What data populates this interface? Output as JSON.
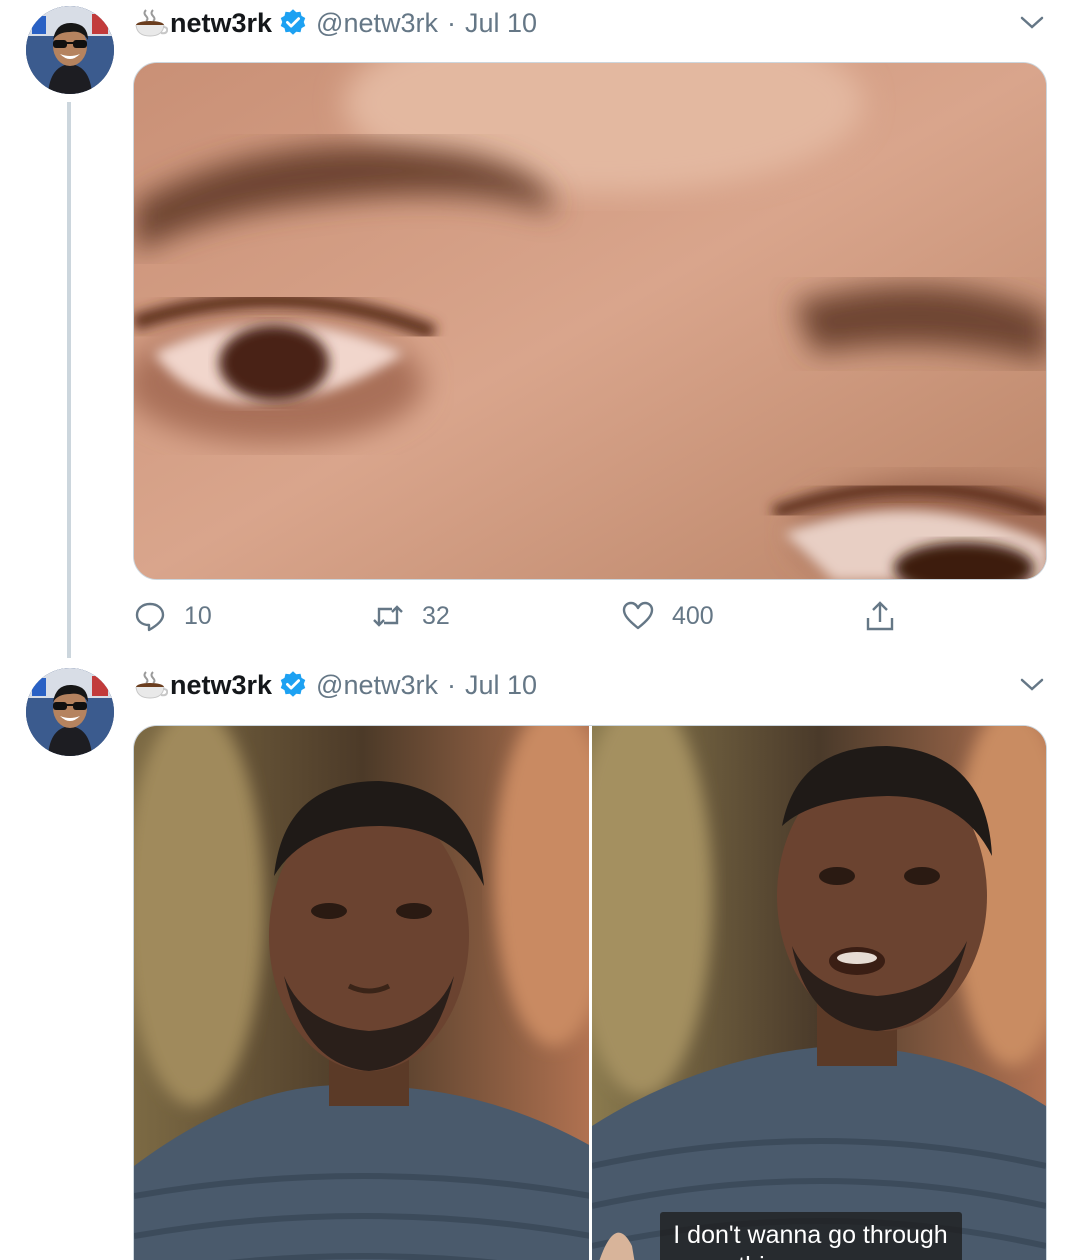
{
  "tweets": [
    {
      "author": {
        "display_name": "netw3rk",
        "handle": "@netw3rk",
        "name_emoji": "coffee-cup-emoji",
        "verified": true,
        "avatar": "avatar-sunglasses-smiling"
      },
      "separator": "·",
      "date": "Jul 10",
      "media": {
        "kind": "single-image",
        "description_icon": "closeup-eyes-photo"
      },
      "actions": {
        "reply_count": "10",
        "retweet_count": "32",
        "like_count": "400"
      }
    },
    {
      "author": {
        "display_name": "netw3rk",
        "handle": "@netw3rk",
        "name_emoji": "coffee-cup-emoji",
        "verified": true,
        "avatar": "avatar-sunglasses-smiling"
      },
      "separator": "·",
      "date": "Jul 10",
      "media": {
        "kind": "two-images",
        "subtitle": "I don't wanna go through this no more."
      }
    }
  ],
  "colors": {
    "name": "#14171a",
    "meta": "#657786",
    "verified": "#1da1f2",
    "thread_line": "#ccd6dd",
    "border": "#ccd6dd"
  }
}
